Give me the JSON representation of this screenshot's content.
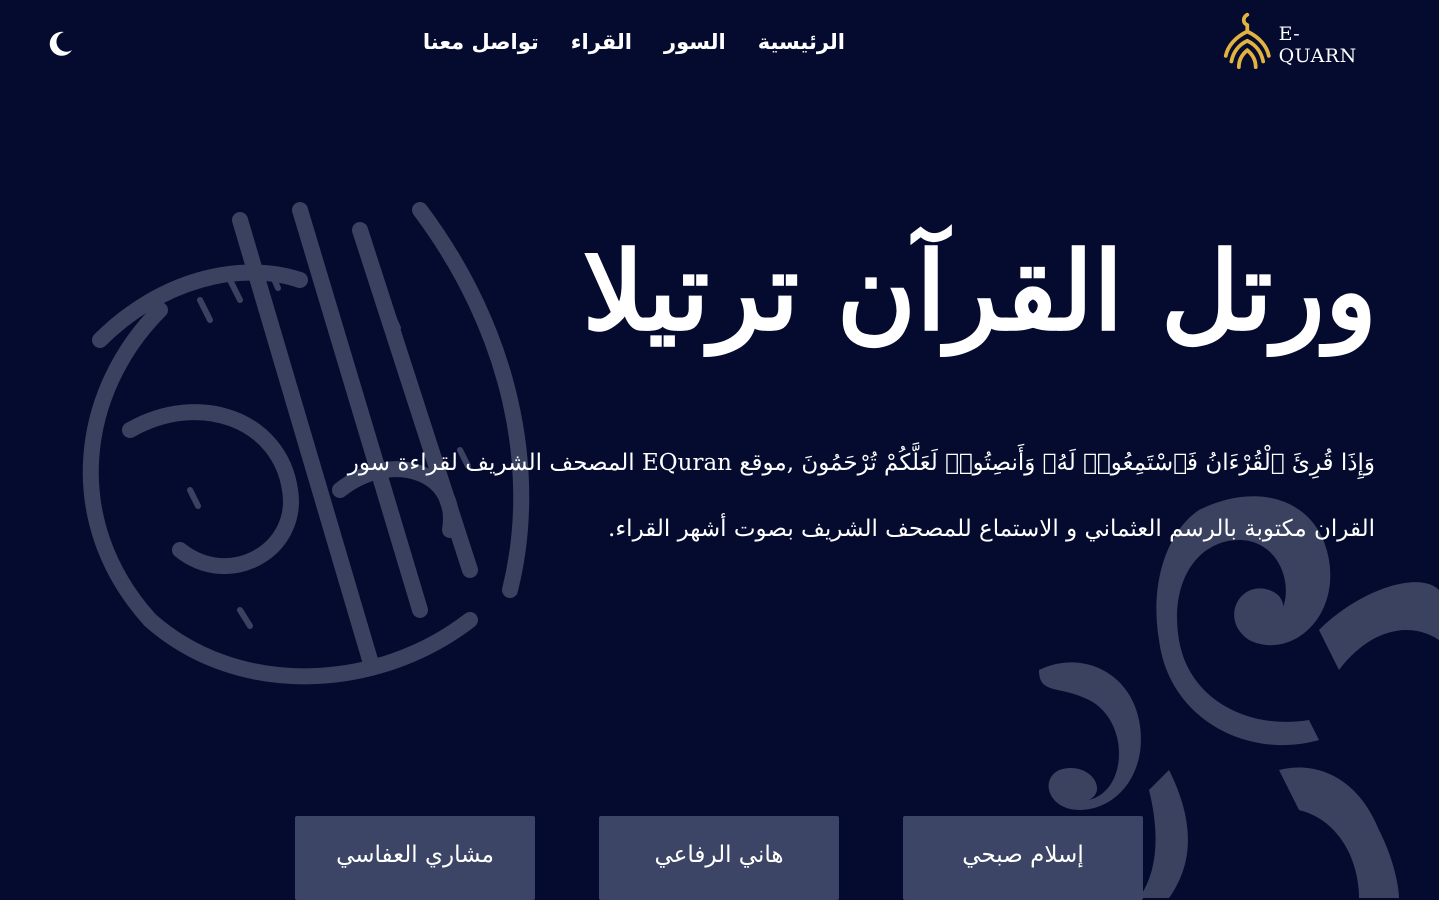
{
  "brand": {
    "logo_text": "E-QUARN"
  },
  "nav": {
    "items": [
      {
        "label": "الرئيسية"
      },
      {
        "label": "السور"
      },
      {
        "label": "القراء"
      },
      {
        "label": "تواصل معنا"
      }
    ]
  },
  "theme_toggle": {
    "icon": "moon-icon"
  },
  "hero": {
    "title": "ورتل القرآن ترتيلا",
    "description": "وَإِذَا قُرِئَ ٱلْقُرْءَانُ فَٱسْتَمِعُوا۟ لَهُۥ وَأَنصِتُوا۟ لَعَلَّكُمْ تُرْحَمُونَ ,موقع EQuran المصحف الشريف لقراءة سور القران مكتوبة بالرسم العثماني و الاستماع للمصحف الشريف بصوت أشهر القراء."
  },
  "reciters": [
    {
      "name": "مشاري العفاسي"
    },
    {
      "name": "هاني الرفاعي"
    },
    {
      "name": "إسلام صبحي"
    }
  ],
  "colors": {
    "background": "#040b2e",
    "decoration": "#3a4260",
    "button": "#3d4566",
    "logo_gold": "#e3b341"
  }
}
